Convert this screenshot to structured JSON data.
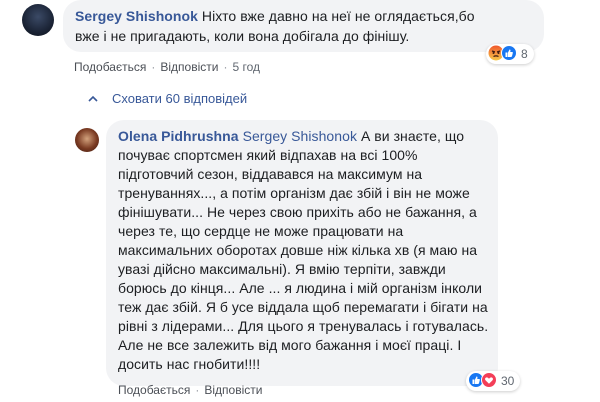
{
  "comment1": {
    "author": "Sergey Shishonok",
    "line1": "Ніхто вже давно на неї не оглядається,бо",
    "line2": "вже і не пригадають, коли вона добігала до фінішу.",
    "like": "Подобається",
    "reply": "Відповісти",
    "time": "5 год",
    "reaction_count": "8",
    "reaction_icons": [
      "angry-icon",
      "like-icon"
    ]
  },
  "hide_replies": {
    "label": "Сховати 60 відповідей",
    "icon": "chevron-up-icon"
  },
  "comment2": {
    "author": "Olena Pidhrushna",
    "mention": "Sergey Shishonok",
    "line1_rest": "А ви знаєте, що",
    "lines": [
      "почуває спортсмен який відпахав на всі 100%",
      "підготовчий сезон, віддавався на максимум на",
      "тренуваннях..., а потім організм дає збій і він не може",
      "фінішувати... Не через свою прихіть або не бажання, а",
      "через те, що сердце не може працювати на",
      "максимальних оборотах довше ніж кілька хв (я маю на",
      "увазі дійсно максимальні). Я вмію терпіти, завжди",
      "борюсь до кінця... Але ... я людина і мій організм інколи",
      "теж дає збій. Я б усе віддала щоб перемагати і бігати на",
      "рівні з лідерами... Для цього я тренувалась і готувалась.",
      "Але не все залежить від мого бажання і моєї праці. І",
      "досить нас гнобити!!!!"
    ],
    "like": "Подобається",
    "reply": "Відповісти",
    "reaction_count": "30",
    "reaction_icons": [
      "like-icon",
      "love-icon"
    ]
  },
  "colors": {
    "link_blue": "#385898",
    "bubble_bg": "#f2f3f5",
    "like_blue": "#1877f2",
    "love_red": "#f33e58",
    "angry_orange": "#e9710f"
  }
}
